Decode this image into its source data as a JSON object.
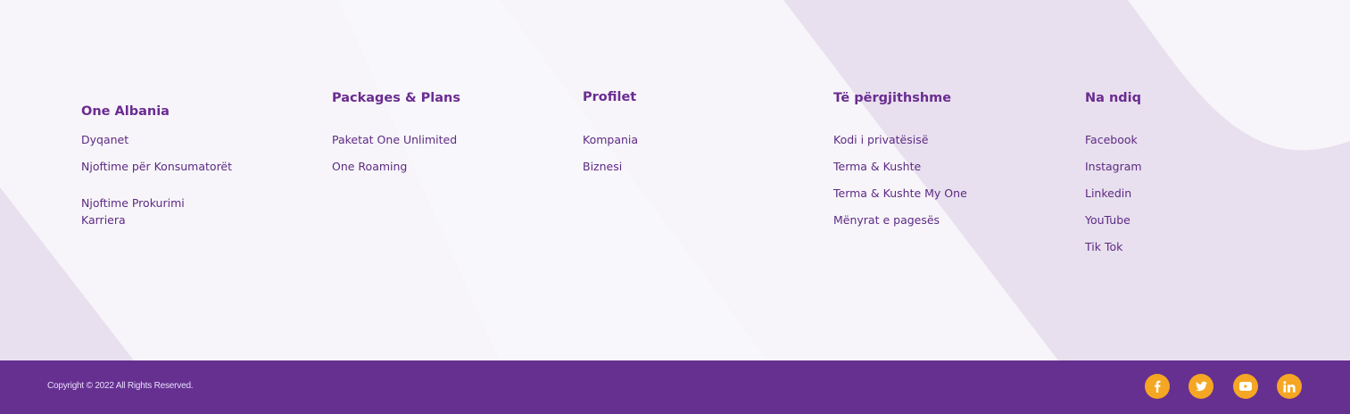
{
  "columns": [
    {
      "title": "One Albania",
      "links": [
        "Dyqanet",
        "Njoftime për Konsumatorët",
        "Njoftime Prokurimi",
        "Karriera"
      ]
    },
    {
      "title": "Packages & Plans",
      "links": [
        "Paketat One Unlimited",
        "One Roaming"
      ]
    },
    {
      "title": "Profilet",
      "links": [
        "Kompania",
        "Biznesi"
      ]
    },
    {
      "title": "Të përgjithshme",
      "links": [
        "Kodi i privatësisë",
        "Terma & Kushte",
        "Terma & Kushte My One",
        "Mënyrat e pagesës"
      ]
    },
    {
      "title": "Na ndiq",
      "links": [
        "Facebook",
        "Instagram",
        "Linkedin",
        "YouTube",
        "Tik Tok"
      ]
    }
  ],
  "copyright": "Copyright © 2022 All Rights Reserved.",
  "social_icons": [
    "facebook-icon",
    "twitter-icon",
    "youtube-icon",
    "linkedin-icon"
  ],
  "colors": {
    "brand_purple": "#663090",
    "heading_purple": "#6a2c91",
    "accent_orange": "#f5a623",
    "background": "#f7f5f9",
    "shape_lavender": "#e8e0ee"
  }
}
